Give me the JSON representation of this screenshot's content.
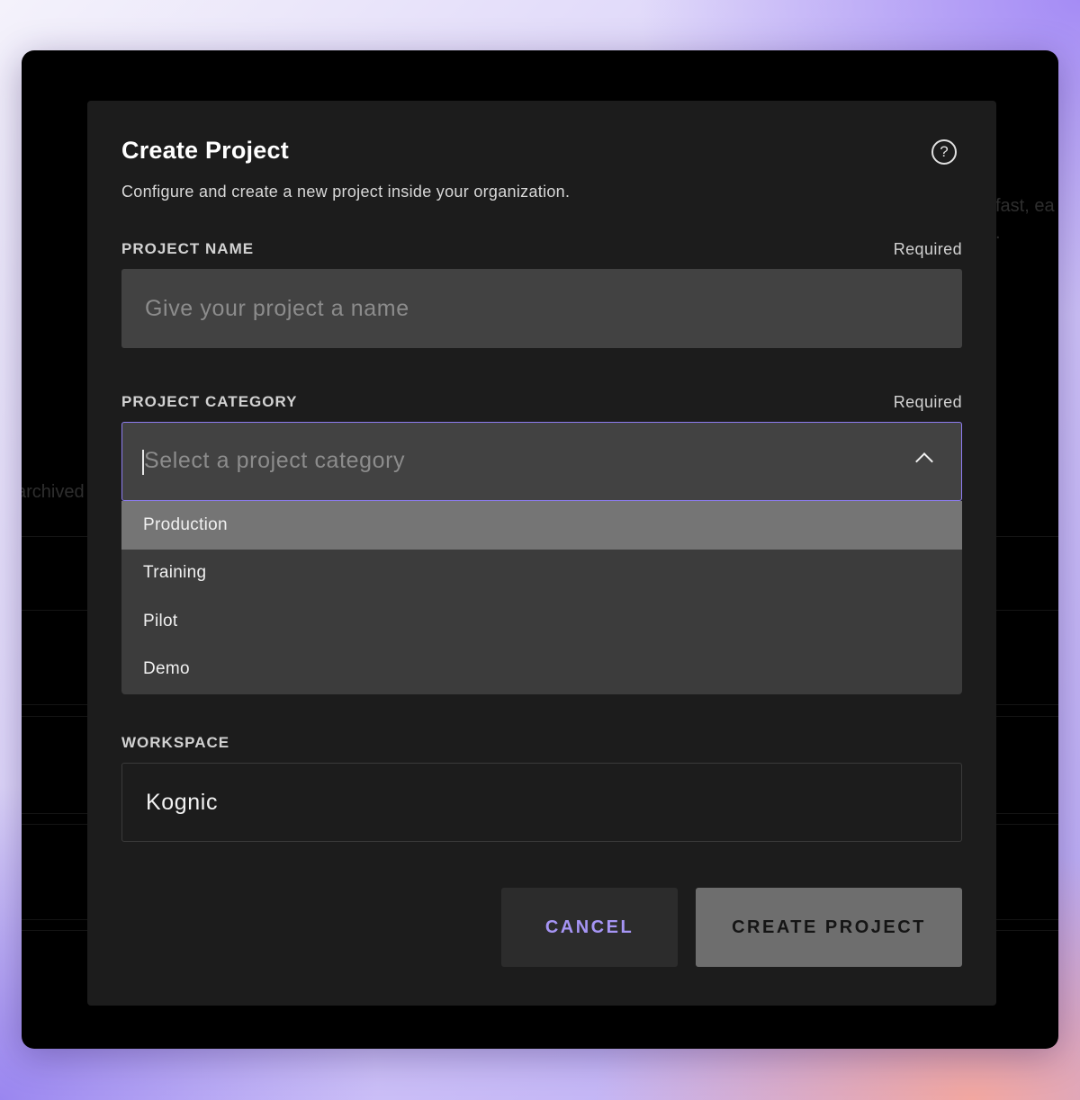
{
  "background": {
    "partial_text_right_1": "fast, ea",
    "partial_text_right_2": ".",
    "partial_text_left": "archived"
  },
  "modal": {
    "title": "Create Project",
    "help_icon": "question-circle-icon",
    "subtitle": "Configure and create a new project inside your organization.",
    "project_name": {
      "label": "PROJECT NAME",
      "required": "Required",
      "value": "",
      "placeholder": "Give your project a name"
    },
    "project_category": {
      "label": "PROJECT CATEGORY",
      "required": "Required",
      "placeholder": "Select a project category",
      "options": [
        "Production",
        "Training",
        "Pilot",
        "Demo"
      ],
      "highlighted_option": "Production"
    },
    "workspace": {
      "label": "WORKSPACE",
      "value": "Kognic"
    },
    "buttons": {
      "cancel": "CANCEL",
      "create": "CREATE PROJECT"
    }
  },
  "colors": {
    "accent": "#8d7cf0",
    "cancel_text": "#a695f5",
    "modal_bg": "#1c1c1c",
    "input_bg": "#424242"
  }
}
